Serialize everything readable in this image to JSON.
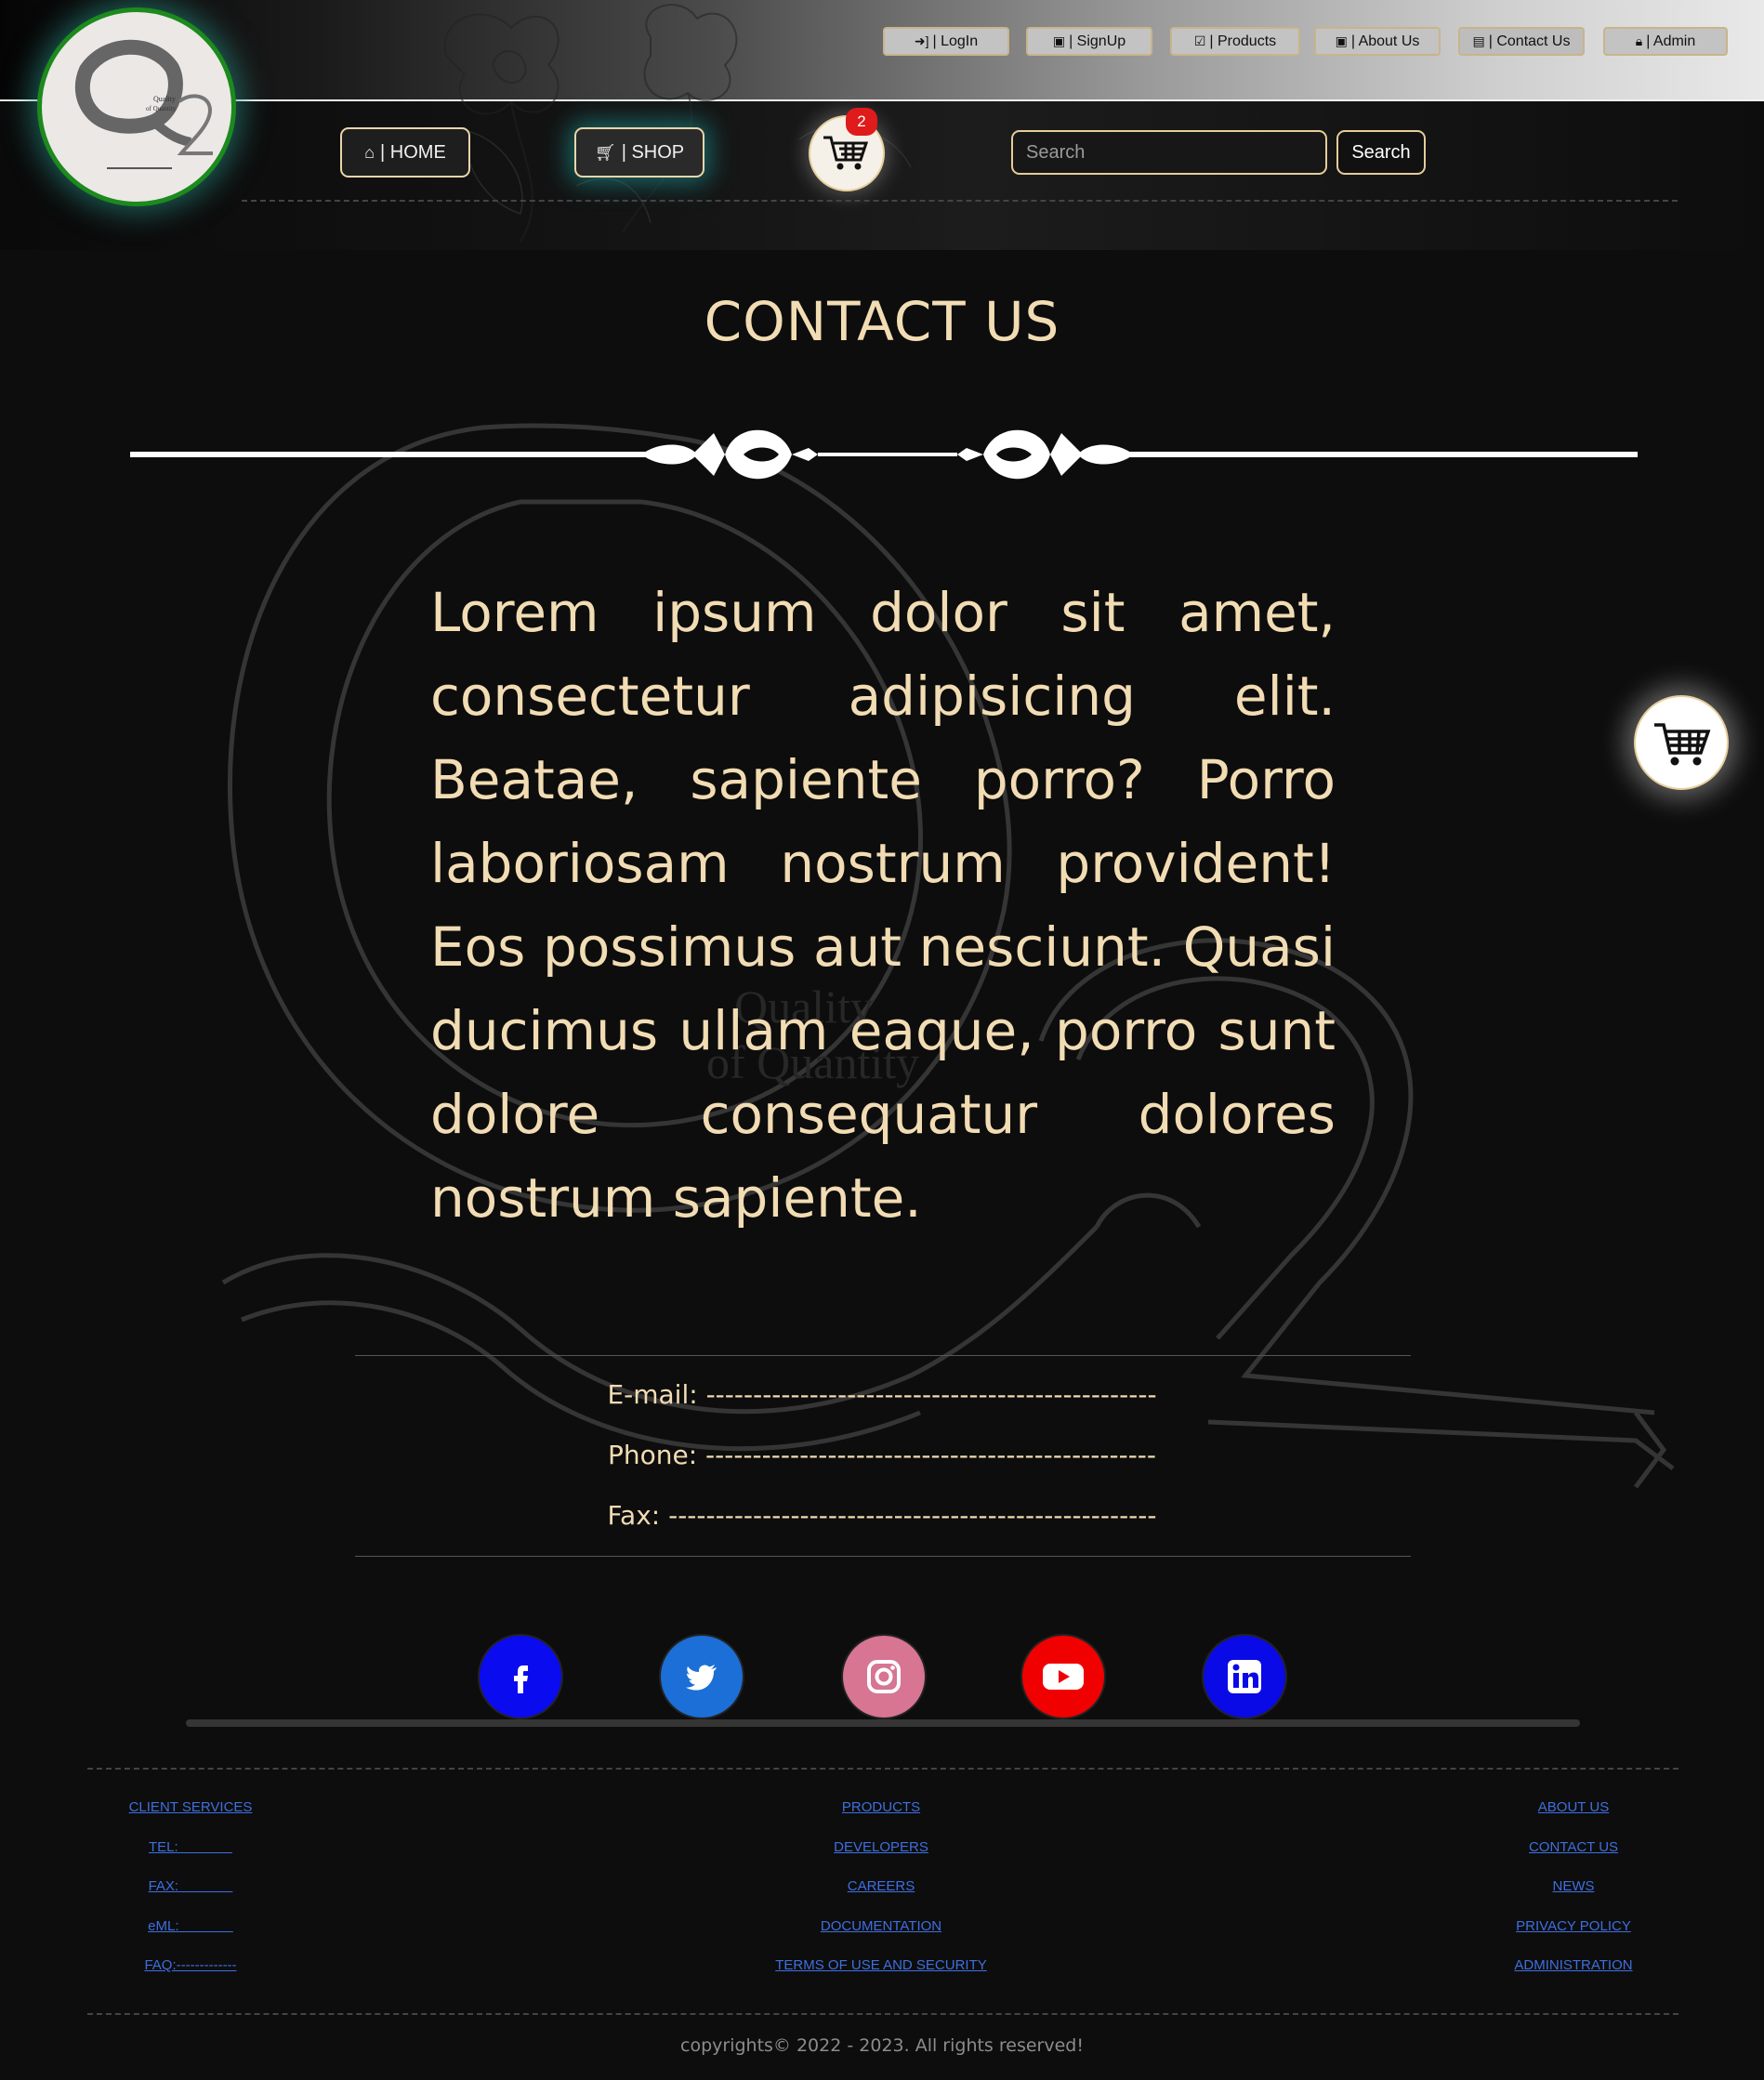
{
  "top_nav": [
    {
      "icon": "login-icon",
      "label": "| LogIn"
    },
    {
      "icon": "signup-icon",
      "label": "| SignUp"
    },
    {
      "icon": "products-icon",
      "label": "| Products"
    },
    {
      "icon": "about-icon",
      "label": "| About Us"
    },
    {
      "icon": "contact-card-icon",
      "label": "| Contact Us"
    },
    {
      "icon": "lock-icon",
      "label": "| Admin"
    }
  ],
  "logo": {
    "line1": "Quality",
    "line2": "of Quantity"
  },
  "main_nav": {
    "home": {
      "icon": "home-icon",
      "label": "| HOME"
    },
    "shop": {
      "icon": "cart-icon",
      "label": "| SHOP"
    }
  },
  "cart": {
    "count": "2"
  },
  "search": {
    "placeholder": "Search",
    "button": "Search"
  },
  "page": {
    "title": "CONTACT US",
    "body": "Lorem ipsum dolor sit amet, consectetur adipisicing elit. Beatae, sapiente porro? Porro laboriosam nostrum provident! Eos possimus aut nesciunt. Quasi ducimus ullam eaque, porro sunt dolore consequatur dolores nostrum sapiente."
  },
  "contact": {
    "email": "E-mail: ------------------------------------------------",
    "phone": "Phone: ------------------------------------------------",
    "fax": "Fax: ----------------------------------------------------"
  },
  "social": [
    {
      "icon": "facebook-icon",
      "color": "#0b0bf0"
    },
    {
      "icon": "twitter-icon",
      "color": "#1b6fd6"
    },
    {
      "icon": "instagram-icon",
      "color": "#d77593"
    },
    {
      "icon": "youtube-icon",
      "color": "#f00000"
    },
    {
      "icon": "linkedin-icon",
      "color": "#0a0ae6"
    }
  ],
  "footer": {
    "left": [
      "CLIENT SERVICES",
      "TEL:              ",
      "FAX:              ",
      "eML:              ",
      "FAQ:-------------"
    ],
    "center": [
      "PRODUCTS",
      "DEVELOPERS",
      "CAREERS",
      "DOCUMENTATION",
      "TERMS OF USE AND SECURITY"
    ],
    "right": [
      "ABOUT US",
      "CONTACT US",
      "NEWS",
      "PRIVACY POLICY",
      "ADMINISTRATION"
    ],
    "copyright": "copyrights© 2022 - 2023. All rights reserved!"
  },
  "colors": {
    "accent": "#f2dcb3",
    "link": "#3e6fe0",
    "badge": "#e01b1b",
    "logo_ring": "#1c8a1c"
  }
}
